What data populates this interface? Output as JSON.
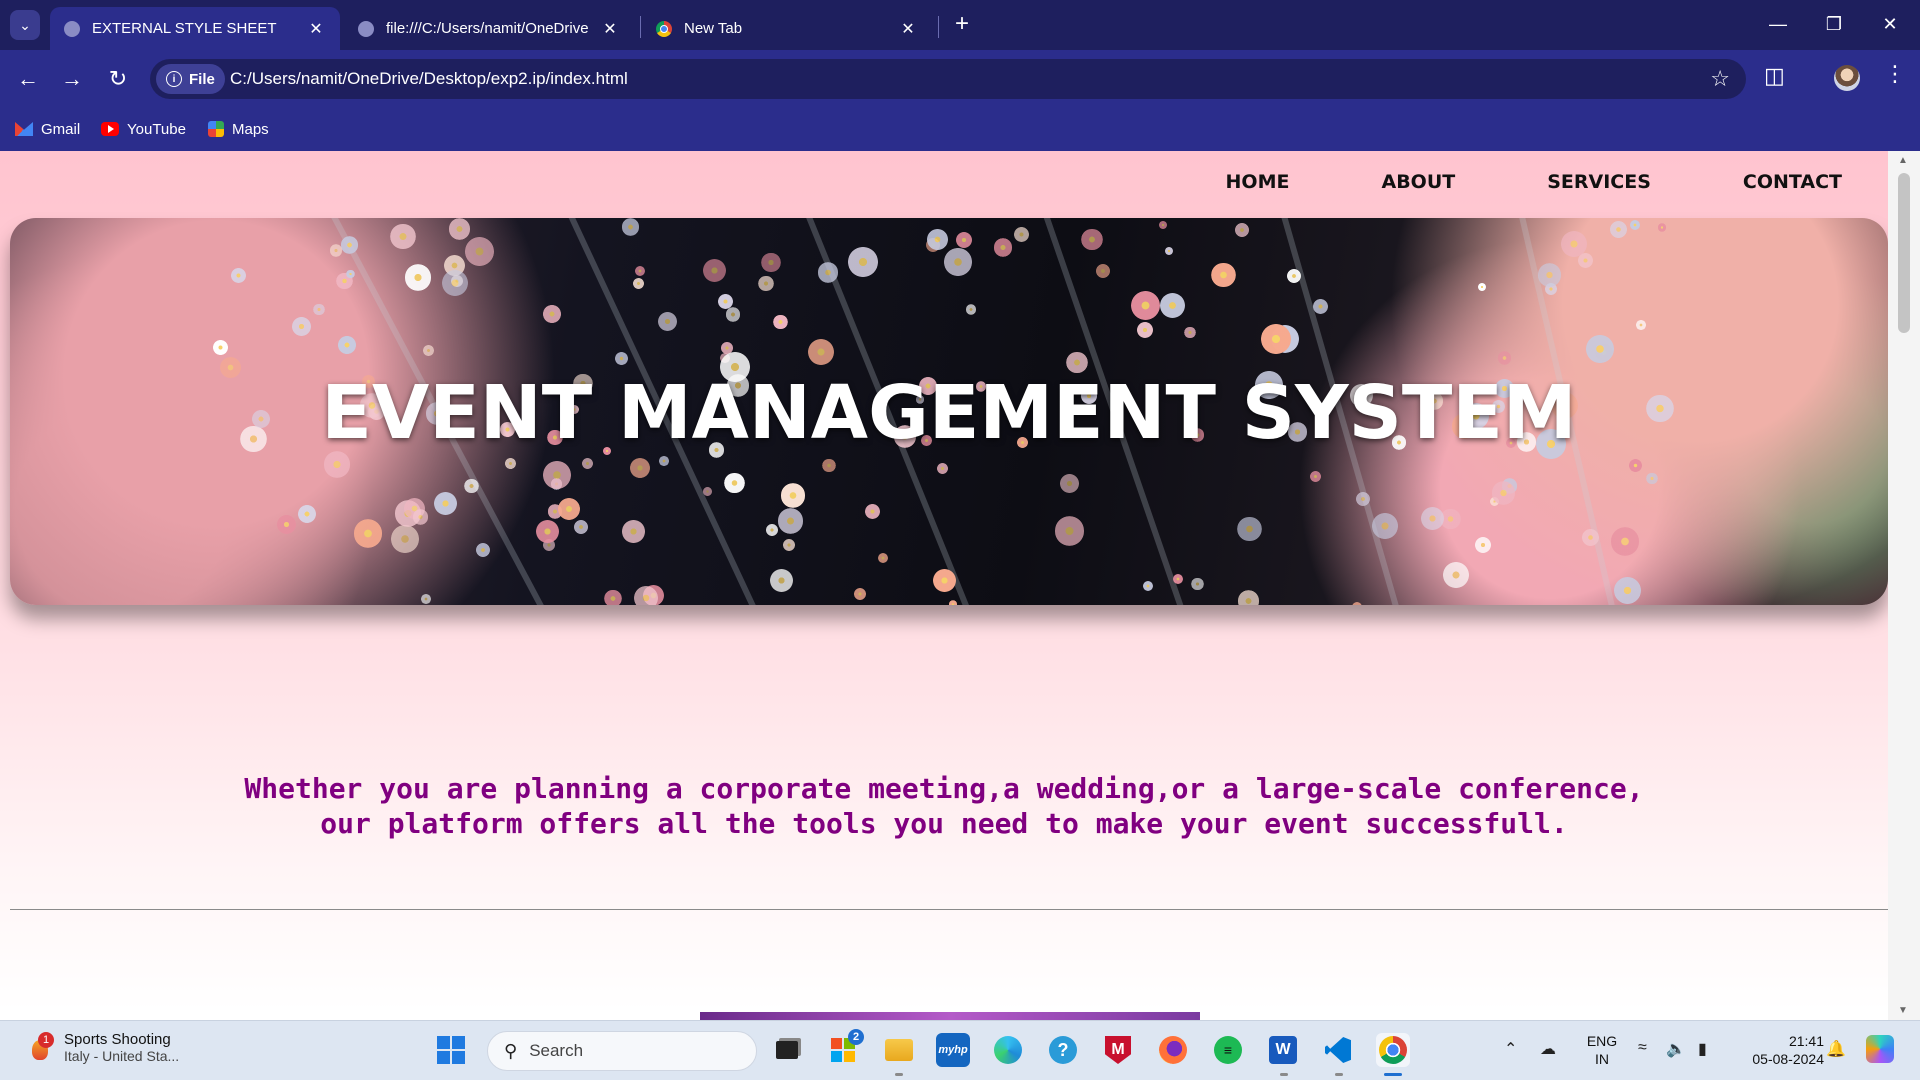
{
  "browser": {
    "tabs": [
      {
        "title": "EXTERNAL STYLE SHEET",
        "active": true
      },
      {
        "title": "file:///C:/Users/namit/OneDrive",
        "active": false
      },
      {
        "title": "New Tab",
        "active": false
      }
    ],
    "address": {
      "chip": "File",
      "url": "C:/Users/namit/OneDrive/Desktop/exp2.ip/index.html"
    },
    "bookmarks": [
      {
        "label": "Gmail",
        "icon": "gmail-icon"
      },
      {
        "label": "YouTube",
        "icon": "youtube-icon"
      },
      {
        "label": "Maps",
        "icon": "maps-icon"
      }
    ],
    "colors": {
      "frame": "#2b2d8c",
      "tabstrip": "#1e1f5e"
    }
  },
  "page": {
    "nav": [
      "HOME",
      "ABOUT",
      "SERVICES",
      "CONTACT"
    ],
    "hero_title": "EVENT MANAGEMENT SYSTEM",
    "tagline": [
      "Whether you are planning a corporate meeting,a wedding,or a large-scale conference,",
      "our platform offers all the tools you need to make your event successfull."
    ],
    "colors": {
      "background_top": "#ffc4cf",
      "tagline": "#800080",
      "nav_text": "#111111"
    }
  },
  "taskbar": {
    "widget": {
      "title": "Sports Shooting",
      "subtitle": "Italy - United Sta...",
      "badge": "1"
    },
    "search_placeholder": "Search",
    "store_badge": "2",
    "apps": [
      "task-view",
      "microsoft-store",
      "file-explorer",
      "myhp",
      "edge",
      "help",
      "mcafee",
      "firefox",
      "spotify",
      "word",
      "vscode",
      "chrome"
    ],
    "language": {
      "line1": "ENG",
      "line2": "IN"
    },
    "clock": {
      "time": "21:41",
      "date": "05-08-2024"
    }
  }
}
